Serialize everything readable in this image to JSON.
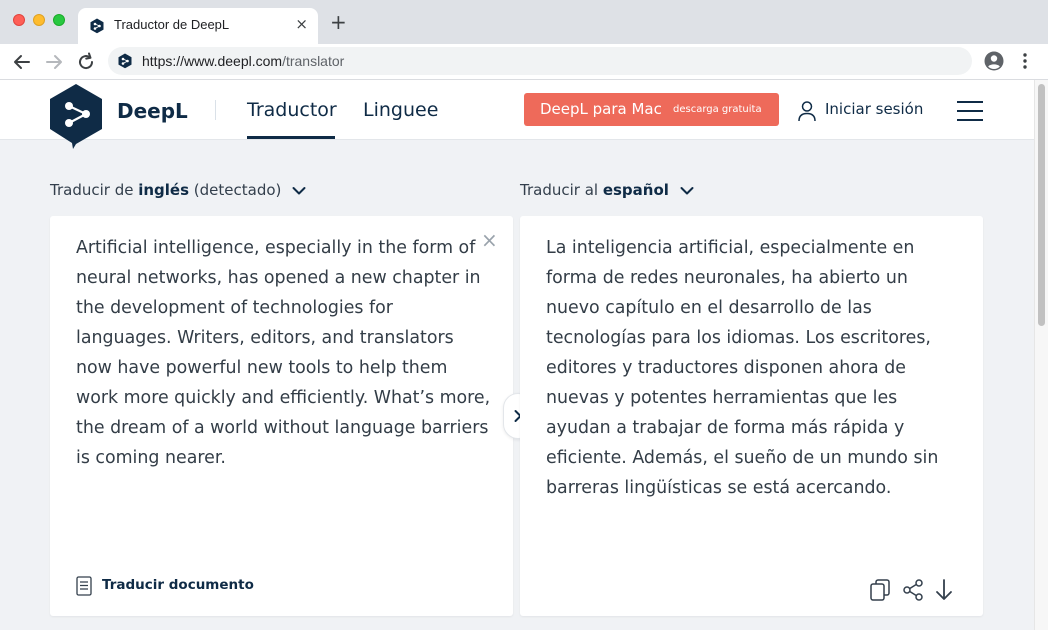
{
  "browser": {
    "tab_title": "Traductor de DeepL",
    "tab_close": "×",
    "new_tab": "+",
    "url_host": "https://www.deepl.com",
    "url_path": "/translator"
  },
  "header": {
    "brand": "DeepL",
    "nav_translator": "Traductor",
    "nav_linguee": "Linguee",
    "cta_main": "DeepL para Mac",
    "cta_sub": "descarga gratuita",
    "login": "Iniciar sesión"
  },
  "source": {
    "prefix": "Traducir de ",
    "language": "inglés",
    "suffix": " (detectado)",
    "text": "Artificial intelligence, especially in the form of neural networks, has opened a new chapter in the development of technologies for languages. Writers, editors, and translators now have powerful new tools to help them work more quickly and efficiently. What’s more, the dream of a world without language barriers is coming nearer.",
    "clear": "×",
    "translate_document": "Traducir documento"
  },
  "target": {
    "prefix": "Traducir al ",
    "language": "español",
    "text": "La inteligencia artificial, especialmente en forma de redes neuronales, ha abierto un nuevo capítulo en el desarrollo de las tecnologías para los idiomas. Los escritores, editores y traductores disponen ahora de nuevas y potentes herramientas que les ayudan a trabajar de forma más rápida y eficiente. Además, el sueño de un mundo sin barreras lingüísticas se está acercando."
  },
  "icons": {
    "swap": "chevron-right-icon",
    "copy": "copy-icon",
    "share": "share-icon",
    "download": "download-icon"
  },
  "colors": {
    "brand_navy": "#0f2b46",
    "cta": "#ee6a5a",
    "page_bg": "#f0f2f5"
  }
}
